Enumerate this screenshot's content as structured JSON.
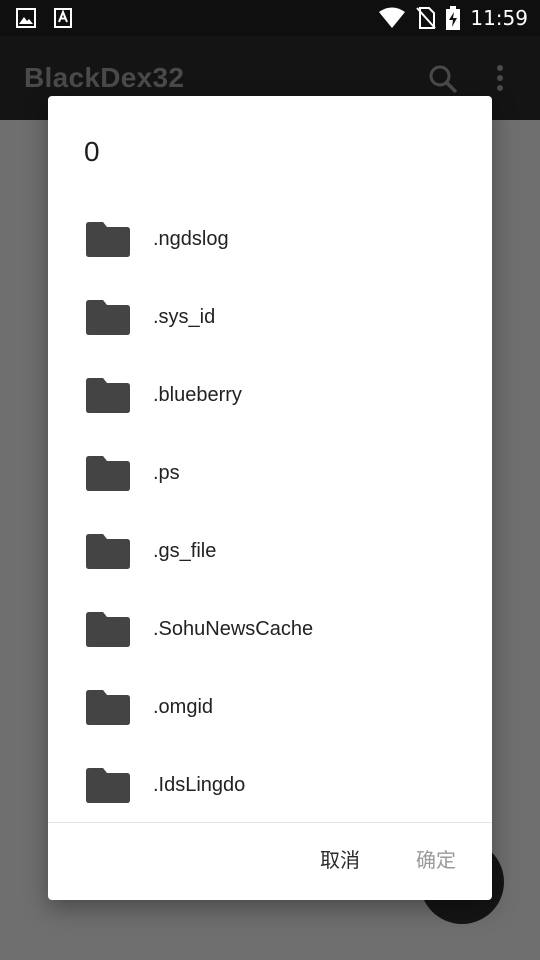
{
  "status_bar": {
    "time": "11:59",
    "icons": [
      "image-notification-icon",
      "font-notification-icon",
      "wifi-icon",
      "no-sim-icon",
      "battery-charging-icon"
    ]
  },
  "app_bar": {
    "title": "BlackDex32",
    "icons": [
      "search-icon",
      "more-vert-icon"
    ]
  },
  "dialog": {
    "title": "0",
    "items": [
      {
        "name": ".ngdslog",
        "icon": "folder-icon"
      },
      {
        "name": ".sys_id",
        "icon": "folder-icon"
      },
      {
        "name": ".blueberry",
        "icon": "folder-icon"
      },
      {
        "name": ".ps",
        "icon": "folder-icon"
      },
      {
        "name": ".gs_file",
        "icon": "folder-icon"
      },
      {
        "name": ".SohuNewsCache",
        "icon": "folder-icon"
      },
      {
        "name": ".omgid",
        "icon": "folder-icon"
      },
      {
        "name": ".IdsLingdo",
        "icon": "folder-icon"
      }
    ],
    "cancel_label": "取消",
    "ok_label": "确定"
  },
  "colors": {
    "scrim": "#6f6f6f",
    "status_bar": "#0f0f0f",
    "folder_icon": "#444444",
    "disabled_text": "#9a9a9a"
  }
}
